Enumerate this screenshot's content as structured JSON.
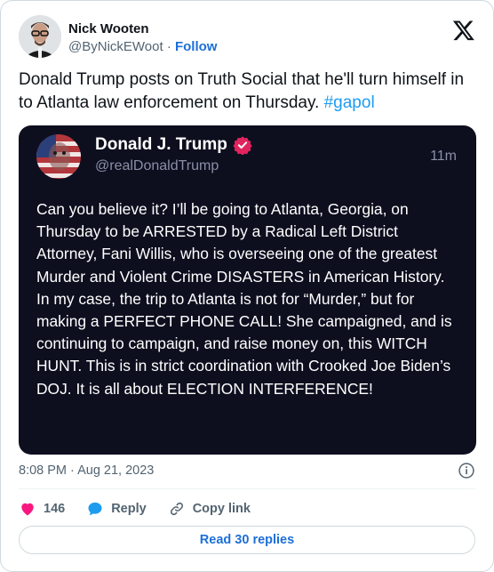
{
  "author": {
    "name": "Nick Wooten",
    "handle": "@ByNickEWoot",
    "separator": "·",
    "follow_label": "Follow"
  },
  "tweet": {
    "text": "Donald Trump posts on Truth Social that he'll turn himself in to Atlanta law enforcement on Thursday. ",
    "hashtag": "#gapol"
  },
  "embed": {
    "name": "Donald J. Trump",
    "handle": "@realDonaldTrump",
    "time": "11m",
    "text": "Can you believe it? I’ll be going to Atlanta, Georgia, on Thursday to be ARRESTED by a Radical Left District Attorney, Fani Willis, who is overseeing one of the greatest Murder and Violent Crime DISASTERS in American History. In my case, the trip to Atlanta is not for “Murder,” but for making a PERFECT PHONE CALL! She campaigned, and is continuing to campaign, and raise money on, this WITCH HUNT. This is in strict coordination with Crooked Joe Biden’s DOJ. It is all about ELECTION INTERFERENCE!"
  },
  "meta": {
    "timestamp": "8:08 PM · Aug 21, 2023"
  },
  "actions": {
    "likes": "146",
    "reply_label": "Reply",
    "copy_link_label": "Copy link"
  },
  "replies_button": "Read 30 replies",
  "colors": {
    "link_blue": "#1d6fd8",
    "hashtag_blue": "#1d9bf0",
    "heart_red": "#f91880",
    "embed_bg": "#0d0f1f",
    "verified_badge": "#e0245e"
  }
}
